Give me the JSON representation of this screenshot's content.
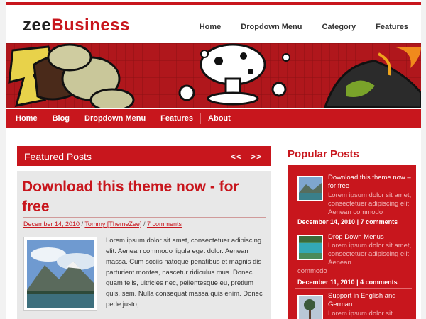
{
  "header": {
    "logo_part1": "zee",
    "logo_part2": "Business",
    "nav": [
      "Home",
      "Dropdown Menu",
      "Category",
      "Features"
    ]
  },
  "main_nav": [
    "Home",
    "Blog",
    "Dropdown Menu",
    "Features",
    "About"
  ],
  "featured": {
    "heading": "Featured Posts",
    "prev": "<<",
    "next": ">>",
    "post": {
      "title": "Download this theme now - for free",
      "date": "December 14, 2010",
      "author": "Tommy [ThemeZee]",
      "comments": "7 comments",
      "body": "Lorem ipsum dolor sit amet, consectetuer adipiscing elit. Aenean commodo ligula eget dolor. Aenean massa. Cum sociis natoque penatibus et magnis dis parturient montes, nascetur ridiculus mus. Donec quam felis, ultricies nec, pellentesque eu, pretium quis, sem. Nulla consequat massa quis enim. Donec pede justo,"
    }
  },
  "popular": {
    "heading": "Popular Posts",
    "items": [
      {
        "title": "Download this theme now – for free",
        "desc_right": "Lorem ipsum dolor sit amet, consectetuer adipiscing elit. Aenean commodo",
        "desc_full": "",
        "date": "December 14, 2010",
        "comments": "7 comments"
      },
      {
        "title": "Drop Down Menus",
        "desc_right": "Lorem ipsum dolor sit amet, consectetuer adipiscing elit. Aenean",
        "desc_full": "commodo",
        "date": "December 11, 2010",
        "comments": "4 comments"
      },
      {
        "title": "Support in English and German",
        "desc_right": "Lorem ipsum dolor sit",
        "desc_full": "",
        "date": "",
        "comments": ""
      }
    ]
  }
}
